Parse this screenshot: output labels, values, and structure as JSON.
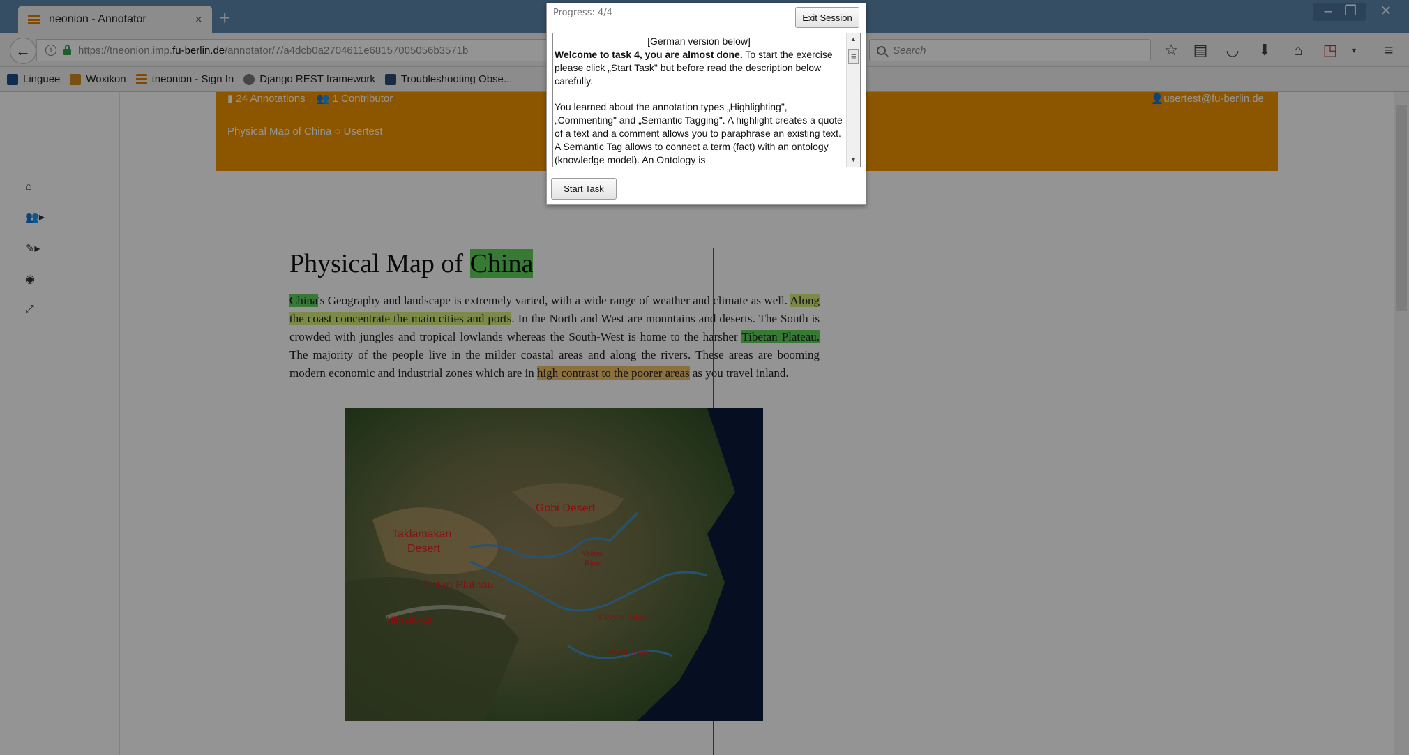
{
  "browser": {
    "tab_title": "neonion - Annotator",
    "tab_close": "×",
    "new_tab": "+",
    "url_prefix": "https://tneonion.imp.",
    "url_host": "fu-berlin.de",
    "url_path": "/annotator/7/a4dcb0a2704611e68157005056b3571b",
    "search_placeholder": "Search",
    "bookmarks": [
      {
        "label": "Linguee",
        "color": "#1c4f8c"
      },
      {
        "label": "Woxikon",
        "color": "#d08a1c"
      },
      {
        "label": "tneonion - Sign In",
        "color": "#e07b00"
      },
      {
        "label": "Django REST framework",
        "color": "#777777"
      },
      {
        "label": "Troubleshooting Obse...",
        "color": "#2e4d78"
      }
    ]
  },
  "header": {
    "annotations": "24 Annotations",
    "contributors": "1 Contributor",
    "document_title": "Physical Map of China",
    "document_user": "Usertest",
    "user_email": "usertest@fu-berlin.de"
  },
  "article": {
    "title_prefix": "Physical Map of ",
    "title_highlight": "China",
    "p1_hl": "China",
    "p1_a": "'s Geography and landscape is extremely varied, with a wide range of weather and climate as well. ",
    "p1_hl2": "Along the coast concentrate the main cities and ports",
    "p1_b": ". In the North and West are mountains and deserts. The South is crowded with jungles and tropical lowlands whereas the South-West is home to the harsher ",
    "p1_hl3": "Tibetan Plateau.",
    "p1_c": " The majority of the people live in the milder coastal areas and along the rivers. These areas are booming modern economic and industrial zones which are in ",
    "p1_hl4": "high contrast to the poorer areas",
    "p1_d": " as you travel inland."
  },
  "map_labels": {
    "gobi": "Gobi Desert",
    "taklamakan_1": "Taklamakan",
    "taklamakan_2": "Desert",
    "yellow_1": "Yellow",
    "yellow_2": "River",
    "tibetan": "Tibetan Plateau",
    "himalayas": "Himalayas",
    "yangtze": "Yangtze River",
    "pearl": "Pearl River"
  },
  "dialog": {
    "progress": "Progress: 4/4",
    "exit_label": "Exit Session",
    "start_label": "Start Task",
    "german_note": "[German version below]",
    "welcome_bold": "Welcome to task 4, you are almost done.",
    "welcome_rest": " To start the exercise please click „Start Task\" but before read the description below carefully.",
    "body": "You learned about the annotation types „Highlighting\", „Commenting\" and „Semantic Tagging\". A highlight creates a quote of a text and a comment allows you to paraphrase an existing text. A Semantic Tag allows to connect a term (fact) with an ontology (knowledge model). An Ontology is"
  },
  "colors": {
    "header_orange": "#f29400",
    "highlight_green": "#5ed35e",
    "highlight_lime": "#d6ee7a",
    "highlight_orange": "#f2c16a",
    "chrome_blue": "#5c87ad"
  }
}
